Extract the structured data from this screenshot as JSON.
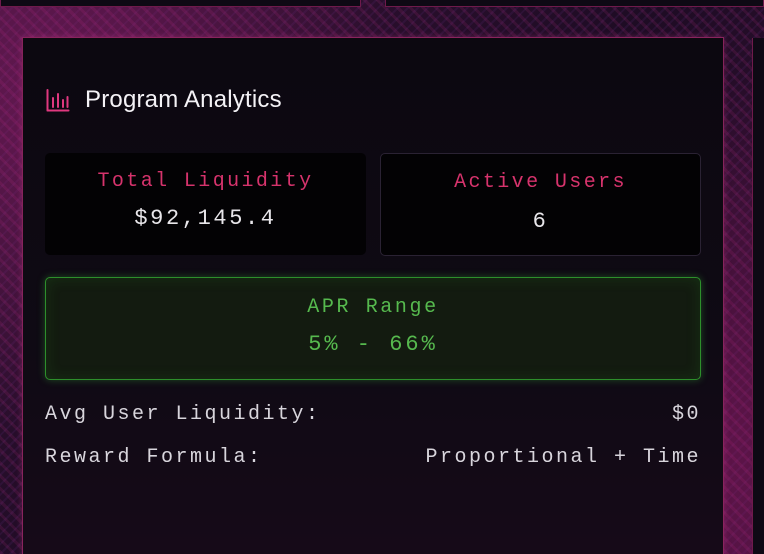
{
  "header": {
    "title": "Program Analytics",
    "icon": "bar-chart-icon",
    "icon_color": "#e0387f"
  },
  "stats": {
    "total_liquidity": {
      "label": "Total Liquidity",
      "value": "$92,145.4"
    },
    "active_users": {
      "label": "Active Users",
      "value": "6"
    }
  },
  "apr": {
    "label": "APR Range",
    "value": "5% - 66%"
  },
  "details": {
    "avg_user_liquidity": {
      "label": "Avg User Liquidity:",
      "value": "$0"
    },
    "reward_formula": {
      "label": "Reward Formula:",
      "value": "Proportional + Time"
    }
  },
  "colors": {
    "accent_pink": "#d6336c",
    "accent_green": "#56b94e",
    "card_border": "#c83282"
  }
}
